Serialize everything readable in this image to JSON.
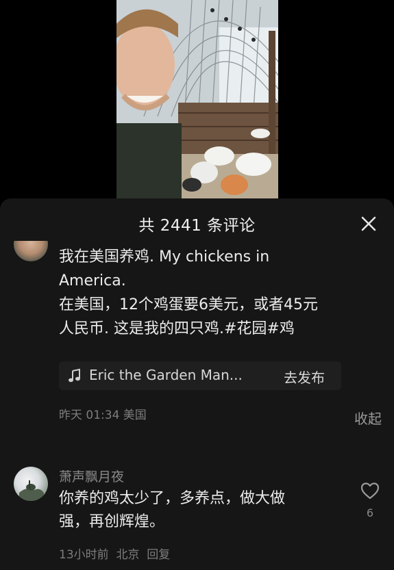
{
  "comments_sheet": {
    "title": "共 2441 条评论",
    "close_icon": "close-icon"
  },
  "pinned_comment": {
    "lines": [
      "我在美国养鸡. My chickens in",
      "America.",
      "在美国，12个鸡蛋要6美元，或者45元",
      "人民币. 这是我的四只鸡.#花园#鸡"
    ],
    "music": {
      "icon": "music-note-icon",
      "song_name": "Eric the Garden Man...",
      "action": "去发布"
    },
    "meta": "昨天 01:34 美国",
    "collapse": "收起"
  },
  "comment": {
    "author": "萧声飘月夜",
    "lines": [
      "你养的鸡太少了，多养点，做大做",
      "强，再创辉煌。"
    ],
    "time": "13小时前",
    "location": "北京",
    "reply": "回复",
    "like_icon": "heart-icon",
    "likes": "6"
  },
  "colors": {
    "sheet_background": "#161616",
    "text_primary": "#ececec",
    "text_secondary": "#7d7d7d"
  }
}
